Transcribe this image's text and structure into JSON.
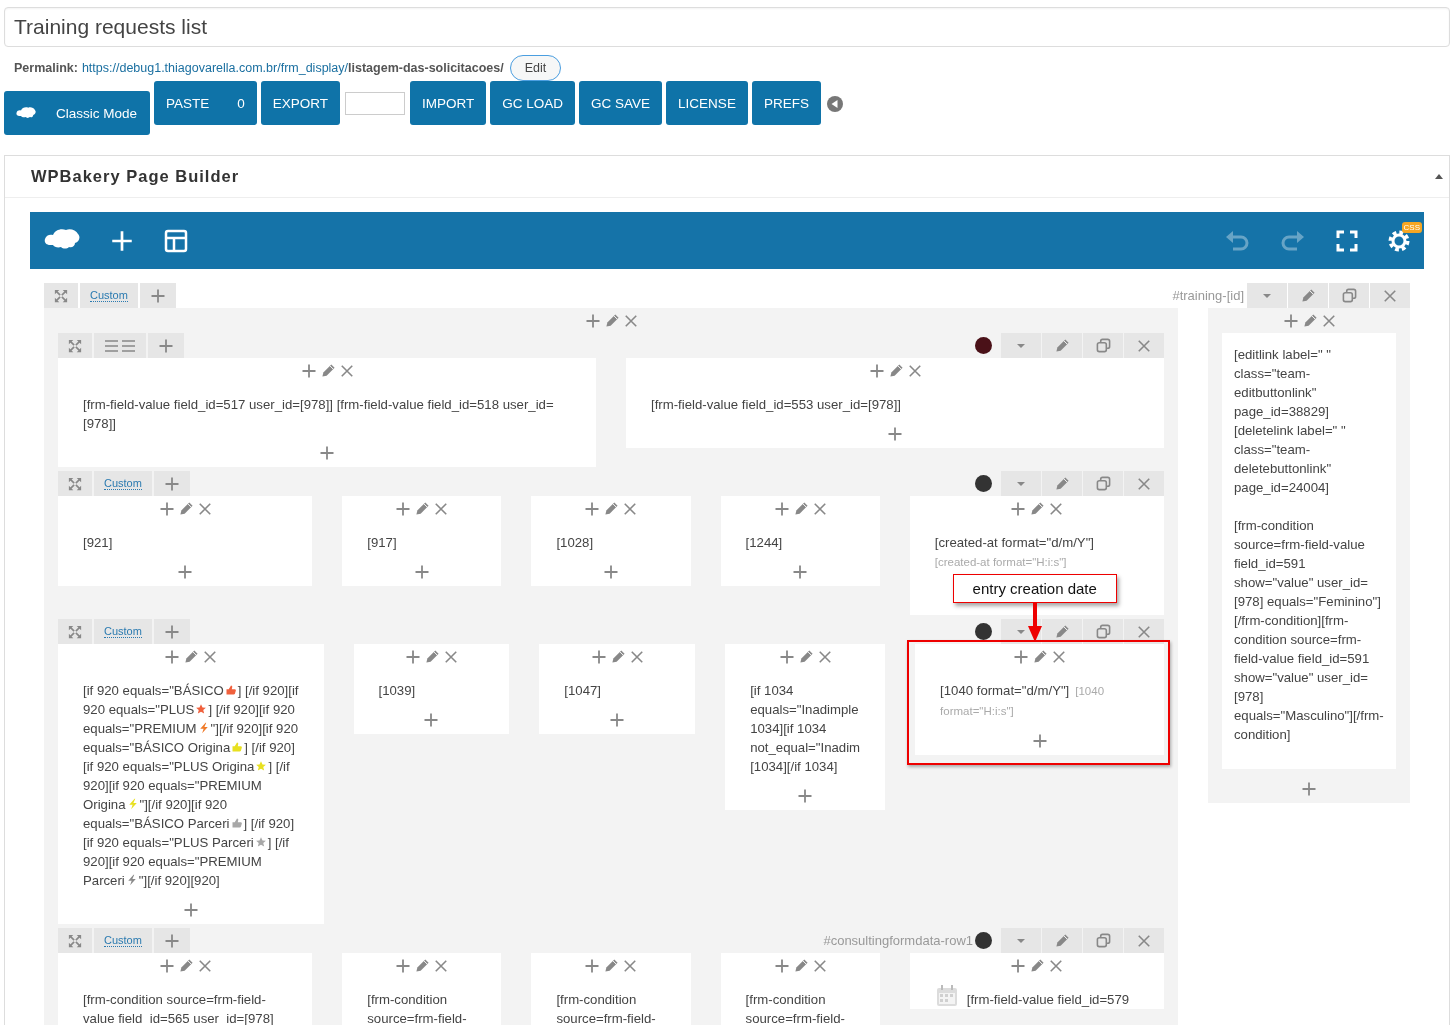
{
  "title_field": {
    "value": "Training requests list"
  },
  "permalink": {
    "label": "Permalink:",
    "url_base": "https://debug1.thiagovarella.com.br/frm_display/",
    "slug": "listagem-das-solicitacoes/",
    "edit_button": "Edit"
  },
  "classic_mode_button": "Classic Mode",
  "toolbar": [
    {
      "kind": "button",
      "label": "PASTE",
      "count": "0"
    },
    {
      "kind": "button",
      "label": "EXPORT"
    },
    {
      "kind": "field"
    },
    {
      "kind": "button",
      "label": "IMPORT"
    },
    {
      "kind": "button",
      "label": "GC LOAD"
    },
    {
      "kind": "button",
      "label": "GC SAVE"
    },
    {
      "kind": "button",
      "label": "LICENSE"
    },
    {
      "kind": "button",
      "label": "PREFS"
    }
  ],
  "panel": {
    "title": "WPBakery Page Builder",
    "expanded": true
  },
  "builder_bar": {
    "css_badge": "CSS",
    "undo_disabled": true,
    "redo_disabled": true
  },
  "row": {
    "label": "Custom",
    "row_id": "#training-[id]",
    "main_column": {
      "rows": [
        {
          "kind": "layout",
          "color": "#4a1118",
          "columns": [
            {
              "highlighted": false,
              "text": "[frm-field-value field_id=517 user_id=[978]] [frm-field-value field_id=518 user_id=[978]]"
            },
            {
              "highlighted": false,
              "text": "[frm-field-value field_id=553 user_id=[978]]"
            }
          ]
        },
        {
          "kind": "custom",
          "label": "Custom",
          "color": "#333333",
          "columns": [
            {
              "highlighted": false,
              "text": "[921]"
            },
            {
              "highlighted": false,
              "text": "[917]"
            },
            {
              "highlighted": false,
              "text": "[1028]"
            },
            {
              "highlighted": false,
              "text": "[1244]"
            },
            {
              "highlighted": false,
              "note": "entry creation date",
              "lines": [
                {
                  "parts": [
                    {
                      "kind": "text",
                      "text": "[created-at format=\"d/m/Y\"]"
                    }
                  ]
                },
                {
                  "parts": [
                    {
                      "kind": "muted",
                      "text": "[created-at format=\"H:i:s\"]"
                    }
                  ]
                }
              ]
            }
          ]
        },
        {
          "kind": "custom",
          "label": "Custom",
          "color": "#333333",
          "columns": [
            {
              "highlighted": false,
              "lines": [
                {
                  "parts": [
                    {
                      "kind": "text",
                      "text": "[if 920 equals=\"BÁSICO"
                    },
                    {
                      "kind": "thumb",
                      "color": "#f0603c"
                    },
                    {
                      "kind": "text",
                      "text": "] [/if 920][if"
                    }
                  ]
                },
                {
                  "parts": [
                    {
                      "kind": "text",
                      "text": "920 equals=\"PLUS"
                    },
                    {
                      "kind": "star",
                      "color": "#f0603c"
                    },
                    {
                      "kind": "text",
                      "text": "] [/if 920][if 920"
                    }
                  ]
                },
                {
                  "parts": [
                    {
                      "kind": "text",
                      "text": "equals=\"PREMIUM"
                    },
                    {
                      "kind": "bolt",
                      "color": "#f07a28"
                    },
                    {
                      "kind": "text",
                      "text": "\"][/if 920][if 920"
                    }
                  ]
                },
                {
                  "parts": [
                    {
                      "kind": "text",
                      "text": "equals=\"BÁSICO Origina"
                    },
                    {
                      "kind": "thumb",
                      "color": "#e8e020"
                    },
                    {
                      "kind": "text",
                      "text": "] [/if 920]"
                    }
                  ]
                },
                {
                  "parts": [
                    {
                      "kind": "text",
                      "text": "[if 920 equals=\"PLUS Origina"
                    },
                    {
                      "kind": "star",
                      "color": "#e8e020"
                    },
                    {
                      "kind": "text",
                      "text": "] [/if"
                    }
                  ]
                },
                {
                  "parts": [
                    {
                      "kind": "text",
                      "text": "920][if 920 equals=\"PREMIUM"
                    }
                  ]
                },
                {
                  "parts": [
                    {
                      "kind": "text",
                      "text": "Origina"
                    },
                    {
                      "kind": "bolt",
                      "color": "#e8e020"
                    },
                    {
                      "kind": "text",
                      "text": "\"][/if 920][if 920"
                    }
                  ]
                },
                {
                  "parts": [
                    {
                      "kind": "text",
                      "text": "equals=\"BÁSICO Parceri"
                    },
                    {
                      "kind": "thumb",
                      "color": "#a8a8a8"
                    },
                    {
                      "kind": "text",
                      "text": "] [/if 920]"
                    }
                  ]
                },
                {
                  "parts": [
                    {
                      "kind": "text",
                      "text": "[if 920 equals=\"PLUS Parceri"
                    },
                    {
                      "kind": "star",
                      "color": "#a8a8a8"
                    },
                    {
                      "kind": "text",
                      "text": "] [/if"
                    }
                  ]
                },
                {
                  "parts": [
                    {
                      "kind": "text",
                      "text": "920][if 920 equals=\"PREMIUM"
                    }
                  ]
                },
                {
                  "parts": [
                    {
                      "kind": "text",
                      "text": "Parceri"
                    },
                    {
                      "kind": "bolt",
                      "color": "#8a8a8a"
                    },
                    {
                      "kind": "text",
                      "text": "\"][/if 920][920]"
                    }
                  ]
                }
              ]
            },
            {
              "highlighted": false,
              "text": "[1039]"
            },
            {
              "highlighted": false,
              "text": "[1047]"
            },
            {
              "highlighted": false,
              "text": "[if 1034\nequals=\"Inadimple\n1034][if 1034\nnot_equal=\"Inadim\n[1034][/if 1034]"
            },
            {
              "highlighted": true,
              "lines": [
                {
                  "parts": [
                    {
                      "kind": "text",
                      "text": "[1040 format=\"d/m/Y\"]"
                    },
                    {
                      "kind": "muted",
                      "text": "[1040"
                    }
                  ]
                },
                {
                  "parts": [
                    {
                      "kind": "muted",
                      "text": "format=\"H:i:s\"]"
                    }
                  ]
                }
              ]
            }
          ]
        },
        {
          "kind": "custom",
          "label": "Custom",
          "row_id": "#consultingformdata-row1",
          "color": "#333333",
          "columns": [
            {
              "highlighted": false,
              "text": "[frm-condition source=frm-field-value field_id=565 user_id=[978]"
            },
            {
              "highlighted": false,
              "text": "[frm-condition source=frm-field-"
            },
            {
              "highlighted": false,
              "text": "[frm-condition source=frm-field-"
            },
            {
              "highlighted": false,
              "text": "[frm-condition source=frm-field-"
            },
            {
              "highlighted": false,
              "lines": [
                {
                  "parts": [
                    {
                      "kind": "calendar"
                    },
                    {
                      "kind": "text",
                      "text": "[frm-field-value field_id=579"
                    }
                  ]
                }
              ]
            }
          ]
        }
      ]
    },
    "side_column": {
      "paragraphs": [
        "[editlink label=\" \" class=\"team-editbuttonlink\" page_id=38829] [deletelink label=\" \" class=\"team-deletebuttonlink\" page_id=24004]",
        "[frm-condition source=frm-field-value field_id=591 show=\"value\" user_id=[978] equals=\"Feminino\"][/frm-condition][frm-condition source=frm-field-value field_id=591 show=\"value\" user_id=[978] equals=\"Masculino\"][/frm-condition]"
      ]
    }
  }
}
